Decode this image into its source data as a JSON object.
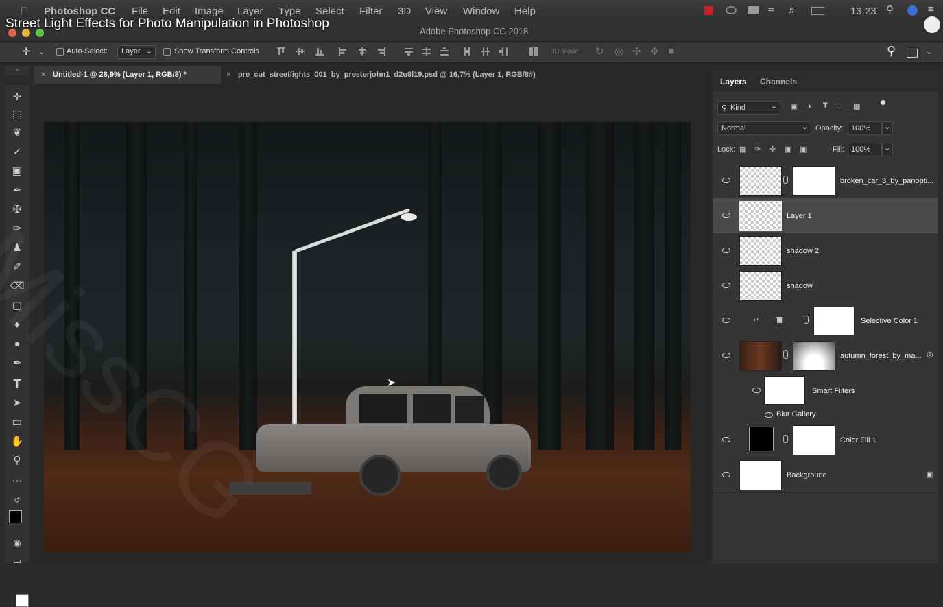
{
  "menubar": {
    "app_name": "Photoshop CC",
    "items": [
      "File",
      "Edit",
      "Image",
      "Layer",
      "Type",
      "Select",
      "Filter",
      "3D",
      "View",
      "Window",
      "Help"
    ],
    "time": "13.23"
  },
  "video_title": "Street Light Effects for Photo Manipulation in Photoshop",
  "window_title": "Adobe Photoshop CC 2018",
  "options": {
    "auto_select_label": "Auto-Select:",
    "auto_select_value": "Layer",
    "show_transform_label": "Show Transform Controls",
    "mode_3d_label": "3D Mode:"
  },
  "tabs": [
    {
      "label": "Untitled-1 @ 28,9% (Layer 1, RGB/8) *",
      "active": true
    },
    {
      "label": "pre_cut_streetlights_001_by_presterjohn1_d2u9l19.psd @ 16,7% (Layer 1, RGB/8#)",
      "active": false
    }
  ],
  "panel": {
    "tabs": [
      "Layers",
      "Channels"
    ],
    "filter_label": "Kind",
    "blend_mode": "Normal",
    "opacity_label": "Opacity:",
    "opacity_value": "100%",
    "lock_label": "Lock:",
    "fill_label": "Fill:",
    "fill_value": "100%",
    "layers": [
      {
        "name": "broken_car_3_by_panopti...",
        "selected": false
      },
      {
        "name": "Layer 1",
        "selected": true
      },
      {
        "name": "shadow 2",
        "selected": false
      },
      {
        "name": "shadow",
        "selected": false
      },
      {
        "name": "Selective Color 1",
        "selected": false
      },
      {
        "name": "autumn_forest_by_ma...",
        "selected": false
      },
      {
        "name": "Smart Filters",
        "selected": false
      },
      {
        "name": "Blur Gallery",
        "selected": false
      },
      {
        "name": "Color Fill 1",
        "selected": false
      },
      {
        "name": "Background",
        "selected": false
      }
    ]
  },
  "watermark": "MissCG",
  "colors": {
    "accent": "#2d8ceb",
    "selected_layer": "#4a4a4a"
  }
}
